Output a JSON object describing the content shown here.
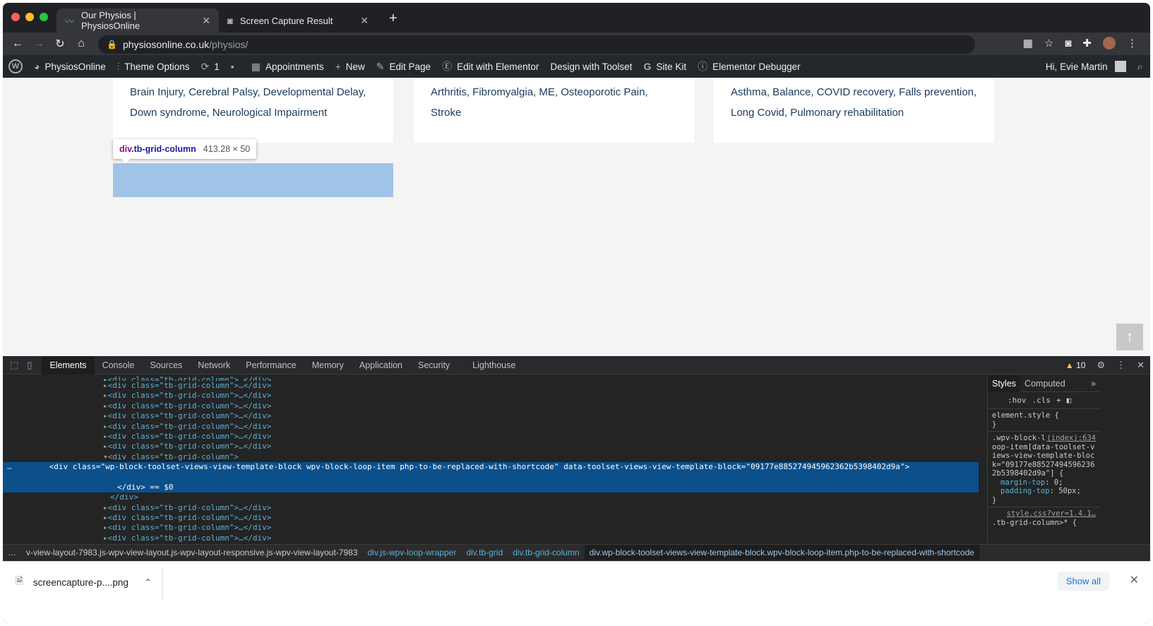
{
  "browser": {
    "tabs": [
      {
        "title": "Our Physios | PhysiosOnline",
        "active": true
      },
      {
        "title": "Screen Capture Result",
        "active": false
      }
    ],
    "url_host": "physiosonline.co.uk",
    "url_path": "/physios/"
  },
  "adminbar": {
    "site_name": "PhysiosOnline",
    "theme_options": "Theme Options",
    "updates_count": "1",
    "appointments": "Appointments",
    "new": "New",
    "edit_page": "Edit Page",
    "edit_elementor": "Edit with Elementor",
    "design_toolset": "Design with Toolset",
    "site_kit": "Site Kit",
    "elementor_debugger": "Elementor Debugger",
    "greeting": "Hi, Evie Martin"
  },
  "page": {
    "cards": [
      {
        "line1": "Brain Injury, Cerebral Palsy, Developmental Delay,",
        "line2": "Down syndrome, Neurological Impairment"
      },
      {
        "line1": "Arthritis, Fibromyalgia, ME, Osteoporotic Pain, Stroke",
        "line2": ""
      },
      {
        "line1": "Asthma, Balance, COVID recovery, Falls prevention,",
        "line2": "Long Covid, Pulmonary rehabilitation"
      }
    ],
    "tooltip": {
      "tag": "div",
      "cls": ".tb-grid-column",
      "dims": "413.28 × 50"
    }
  },
  "devtools": {
    "tabs": [
      "Elements",
      "Console",
      "Sources",
      "Network",
      "Performance",
      "Memory",
      "Application",
      "Security",
      "Lighthouse"
    ],
    "active_tab": "Elements",
    "warnings": "10",
    "elements_lines": {
      "collapsed_div": "<div class=\"tb-grid-column\">…</div>",
      "open_div": "<div class=\"tb-grid-column\">",
      "selected_div": "<div class=\"wp-block-toolset-views-view-template-block wpv-block-loop-item php-to-be-replaced-with-shortcode\" data-toolset-views-view-template-block=\"09177e885274945962362b5398402d9a\">",
      "selected_close": "</div> == $0",
      "close_div": "</div>"
    },
    "styles": {
      "tabs": [
        "Styles",
        "Computed"
      ],
      "hov": ":hov",
      "cls": ".cls",
      "element_style": "element.style {",
      "close_brace": "}",
      "rule_selector": ".wpv-block-loop-item[data-toolset-views-view-template-block=\"09177e885274945962362b5398402d9a\"] {",
      "rule_source": "(index):634",
      "decl1_prop": "margin-top",
      "decl1_val": "0;",
      "decl2_prop": "padding-top",
      "decl2_val": "50px;",
      "next_source": "style.css?ver=1.4.1…",
      "next_selector": ".tb-grid-column>* {"
    },
    "breadcrumb": [
      "…",
      "v-view-layout-7983.js-wpv-view-layout.js-wpv-layout-responsive.js-wpv-view-layout-7983",
      "div.js-wpv-loop-wrapper",
      "div.tb-grid",
      "div.tb-grid-column",
      "div.wp-block-toolset-views-view-template-block.wpv-block-loop-item.php-to-be-replaced-with-shortcode"
    ]
  },
  "download": {
    "filename": "screencapture-p....png",
    "show_all": "Show all"
  },
  "colors": {
    "selection": "#0b4f8b",
    "highlight": "#9fc4e7",
    "adminbar": "#23282d"
  }
}
